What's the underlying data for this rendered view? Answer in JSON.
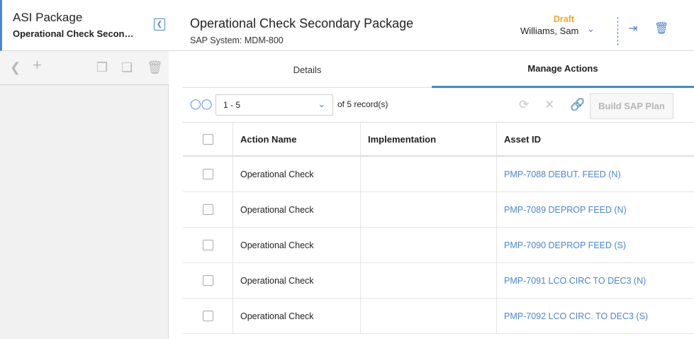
{
  "left_panel": {
    "title": "ASI Package",
    "subtitle": "Operational Check Secondary Package",
    "collapse_icon": "chevron-left-icon",
    "toolbar_icons": [
      "back-icon",
      "add-icon",
      "copy-icon",
      "paste-icon",
      "delete-icon"
    ]
  },
  "header": {
    "title": "Operational Check Secondary Package",
    "subtitle": "SAP System: MDM-800",
    "status": "Draft",
    "user": "Williams, Sam",
    "icons": [
      "chevron-down-icon",
      "export-icon",
      "trash-icon"
    ],
    "status_color": "#f5a623",
    "accent_color": "#4a86d6"
  },
  "tabs": [
    {
      "label": "Details",
      "active": false
    },
    {
      "label": "Manage Actions",
      "active": true
    }
  ],
  "grid_toolbar": {
    "search_icon": "binoculars-icon",
    "pager_value": "1 - 5",
    "records_text": "of",
    "records_count": "5",
    "records_suffix": "record(s)",
    "build_button": "Build SAP Plan",
    "icons": [
      "refresh-icon",
      "remove-icon",
      "link-icon"
    ]
  },
  "table": {
    "columns": [
      "Action Name",
      "Implementation",
      "Asset ID"
    ],
    "rows": [
      {
        "action": "Operational Check",
        "implementation": "",
        "asset": "PMP-7088 DEBUT. FEED (N)"
      },
      {
        "action": "Operational Check",
        "implementation": "",
        "asset": "PMP-7089 DEPROP FEED (N)"
      },
      {
        "action": "Operational Check",
        "implementation": "",
        "asset": "PMP-7090 DEPROP FEED (S)"
      },
      {
        "action": "Operational Check",
        "implementation": "",
        "asset": "PMP-7091 LCO CIRC TO DEC3 (N)"
      },
      {
        "action": "Operational Check",
        "implementation": "",
        "asset": "PMP-7092 LCO CIRC. TO DEC3 (S)"
      }
    ]
  }
}
